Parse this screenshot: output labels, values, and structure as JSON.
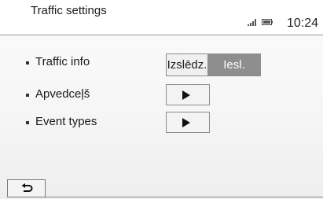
{
  "header": {
    "title": "Traffic settings",
    "clock": "10:24",
    "signal_icon": "signal-icon",
    "battery_icon": "battery-icon"
  },
  "settings": [
    {
      "label": "Traffic info",
      "control": "toggle"
    },
    {
      "label": "Apvedceļš",
      "control": "play-button"
    },
    {
      "label": "Event types",
      "control": "play-button"
    }
  ],
  "traffic_toggle": {
    "off_label": "Izslēdz.",
    "on_label": "Iesl.",
    "selected": "on"
  },
  "icons": {
    "play": "play-icon",
    "back": "back-arrow-icon"
  },
  "colors": {
    "toggle_selected": "#8e8e8e",
    "text": "#1a1a1a"
  }
}
